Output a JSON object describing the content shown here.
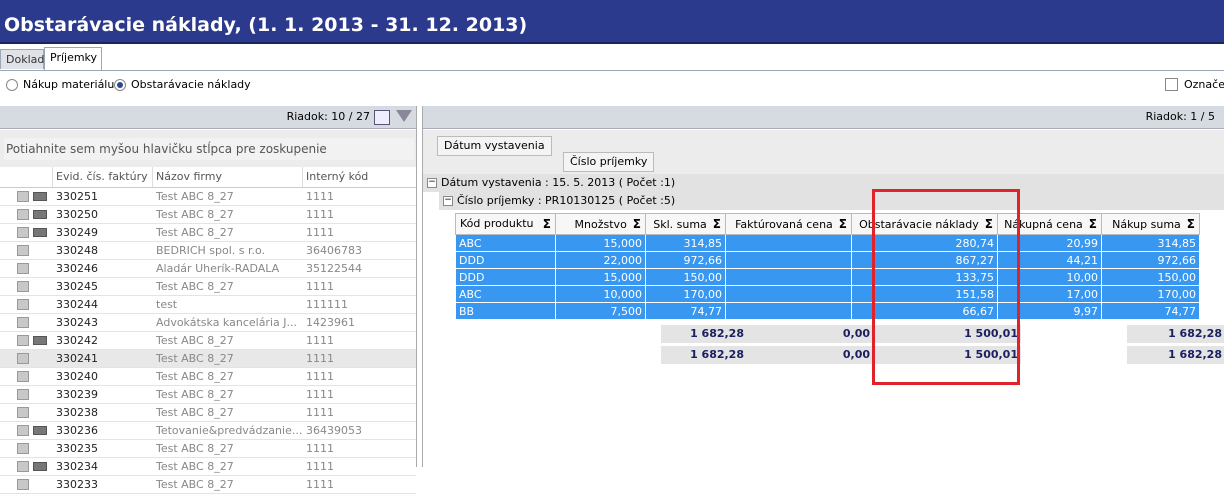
{
  "window": {
    "title": "Obstarávacie náklady,  (1. 1. 2013 - 31. 12. 2013)"
  },
  "tabs": [
    "Doklad",
    "Príjemky"
  ],
  "radios": [
    {
      "label": "Nákup materiálu",
      "selected": false
    },
    {
      "label": "Obstarávacie náklady",
      "selected": true
    }
  ],
  "checkbox": {
    "label": "Označe"
  },
  "left": {
    "row_counter": "Riadok: 10 / 27",
    "group_hint": "Potiahnite sem myšou hlavičku stĺpca pre zoskupenie",
    "columns": [
      "Evid. čís. faktúry",
      "Názov firmy",
      "Interný kód"
    ],
    "rows": [
      {
        "n": "330251",
        "f": "Test ABC 8_27",
        "k": "1111"
      },
      {
        "n": "330250",
        "f": "Test ABC 8_27",
        "k": "1111"
      },
      {
        "n": "330249",
        "f": "Test ABC 8_27",
        "k": "1111"
      },
      {
        "n": "330248",
        "f": "BEDRICH spol. s r.o.",
        "k": "36406783"
      },
      {
        "n": "330246",
        "f": "Aladár Uherík-RADALA",
        "k": "35122544"
      },
      {
        "n": "330245",
        "f": "Test ABC 8_27",
        "k": "1111"
      },
      {
        "n": "330244",
        "f": "test",
        "k": "111111"
      },
      {
        "n": "330243",
        "f": "Advokátska kancelária J...",
        "k": "1423961"
      },
      {
        "n": "330242",
        "f": "Test ABC 8_27",
        "k": "1111"
      },
      {
        "n": "330241",
        "f": "Test ABC 8_27",
        "k": "1111"
      },
      {
        "n": "330240",
        "f": "Test ABC 8_27",
        "k": "1111"
      },
      {
        "n": "330239",
        "f": "Test ABC 8_27",
        "k": "1111"
      },
      {
        "n": "330238",
        "f": "Test ABC 8_27",
        "k": "1111"
      },
      {
        "n": "330236",
        "f": "Tetovanie&predvádzanie...",
        "k": "36439053"
      },
      {
        "n": "330235",
        "f": "Test ABC 8_27",
        "k": "1111"
      },
      {
        "n": "330234",
        "f": "Test ABC 8_27",
        "k": "1111"
      },
      {
        "n": "330233",
        "f": "Test ABC 8_27",
        "k": "1111"
      }
    ]
  },
  "right": {
    "row_counter": "Riadok: 1 / 5",
    "group_btn1": "Dátum vystavenia",
    "group_btn2": "Číslo príjemky",
    "level1": "Dátum vystavenia : 15. 5. 2013 ( Počet :1)",
    "level2": "Číslo príjemky : PR10130125 ( Počet :5)",
    "columns": [
      "Kód produktu",
      "Množstvo",
      "Skl. suma",
      "Faktúrovaná cena",
      "Obstarávacie náklady",
      "Nákupná cena",
      "Nákup suma"
    ],
    "rows": [
      [
        "ABC",
        "15,000",
        "314,85",
        "",
        "280,74",
        "20,99",
        "314,85"
      ],
      [
        "DDD",
        "22,000",
        "972,66",
        "",
        "867,27",
        "44,21",
        "972,66"
      ],
      [
        "DDD",
        "15,000",
        "150,00",
        "",
        "133,75",
        "10,00",
        "150,00"
      ],
      [
        "ABC",
        "10,000",
        "170,00",
        "",
        "151,58",
        "17,00",
        "170,00"
      ],
      [
        "BB",
        "7,500",
        "74,77",
        "",
        "66,67",
        "9,97",
        "74,77"
      ]
    ],
    "totals": {
      "skl": "1 682,28",
      "fakt": "0,00",
      "obst": "1 500,01",
      "nakup": "1 682,28"
    },
    "sigma": "Σ"
  }
}
